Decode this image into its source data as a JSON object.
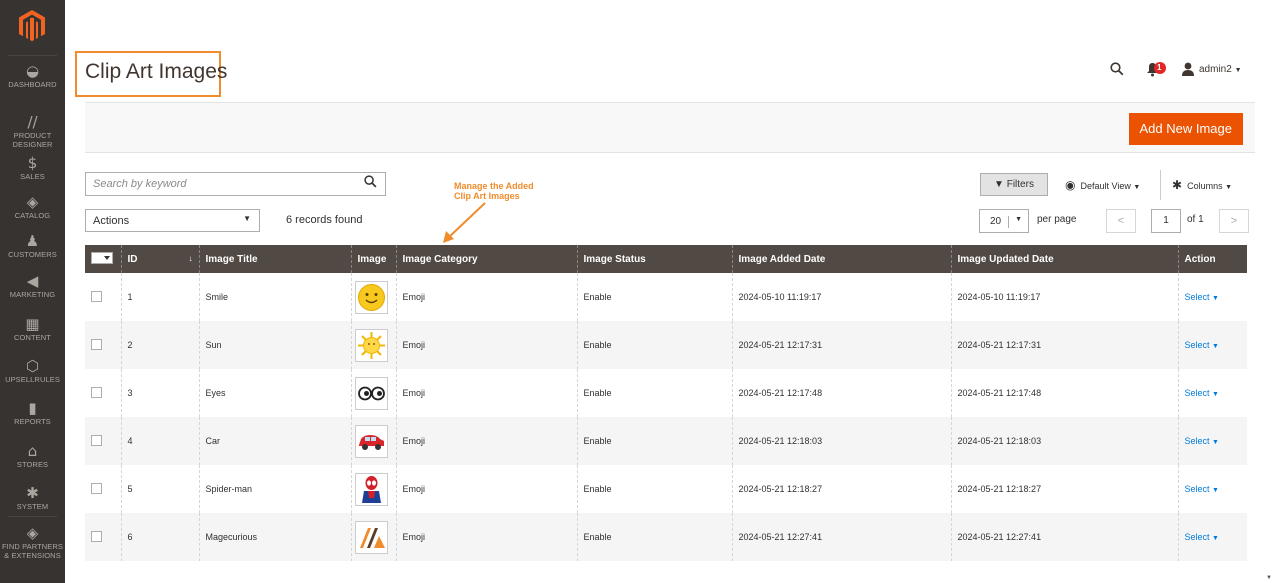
{
  "sidebar": {
    "items": [
      {
        "label": "Dashboard",
        "icon": "dashboard-icon",
        "glyph": "◒"
      },
      {
        "label": "Product Designer",
        "icon": "product-designer-icon",
        "glyph": "//"
      },
      {
        "label": "Sales",
        "icon": "sales-icon",
        "glyph": "$"
      },
      {
        "label": "Catalog",
        "icon": "catalog-icon",
        "glyph": "◈"
      },
      {
        "label": "Customers",
        "icon": "customers-icon",
        "glyph": "♟"
      },
      {
        "label": "Marketing",
        "icon": "marketing-icon",
        "glyph": "◀"
      },
      {
        "label": "Content",
        "icon": "content-icon",
        "glyph": "▦"
      },
      {
        "label": "Upsellrules",
        "icon": "upsellrules-icon",
        "glyph": "⬡"
      },
      {
        "label": "Reports",
        "icon": "reports-icon",
        "glyph": "▮"
      },
      {
        "label": "Stores",
        "icon": "stores-icon",
        "glyph": "⌂"
      },
      {
        "label": "System",
        "icon": "system-icon",
        "glyph": "✱"
      },
      {
        "label": "Find Partners & Extensions",
        "icon": "partners-icon",
        "glyph": "◈"
      }
    ]
  },
  "header": {
    "title": "Clip Art Images",
    "notification_count": "1",
    "user": "admin2"
  },
  "page_actions": {
    "add_label": "Add New Image"
  },
  "toolbar": {
    "search_placeholder": "Search by keyword",
    "actions_label": "Actions",
    "records_found": "6 records found",
    "filters_label": "Filters",
    "default_view_label": "Default View",
    "columns_label": "Columns",
    "per_page_value": "20",
    "per_page_label": "per page",
    "page_current": "1",
    "page_of": "of 1"
  },
  "annotation": {
    "line1": "Manage the Added",
    "line2": "Clip Art Images"
  },
  "grid": {
    "headers": {
      "id": "ID",
      "title": "Image Title",
      "image": "Image",
      "category": "Image Category",
      "status": "Image Status",
      "added": "Image Added Date",
      "updated": "Image Updated Date",
      "action": "Action"
    },
    "rows": [
      {
        "id": "1",
        "title": "Smile",
        "category": "Emoji",
        "status": "Enable",
        "added": "2024-05-10 11:19:17",
        "updated": "2024-05-10 11:19:17",
        "action": "Select",
        "thumb": "smile-emoji-thumbnail"
      },
      {
        "id": "2",
        "title": "Sun",
        "category": "Emoji",
        "status": "Enable",
        "added": "2024-05-21 12:17:31",
        "updated": "2024-05-21 12:17:31",
        "action": "Select",
        "thumb": "sun-thumbnail"
      },
      {
        "id": "3",
        "title": "Eyes",
        "category": "Emoji",
        "status": "Enable",
        "added": "2024-05-21 12:17:48",
        "updated": "2024-05-21 12:17:48",
        "action": "Select",
        "thumb": "eyes-thumbnail"
      },
      {
        "id": "4",
        "title": "Car",
        "category": "Emoji",
        "status": "Enable",
        "added": "2024-05-21 12:18:03",
        "updated": "2024-05-21 12:18:03",
        "action": "Select",
        "thumb": "car-thumbnail"
      },
      {
        "id": "5",
        "title": "Spider-man",
        "category": "Emoji",
        "status": "Enable",
        "added": "2024-05-21 12:18:27",
        "updated": "2024-05-21 12:18:27",
        "action": "Select",
        "thumb": "spiderman-thumbnail"
      },
      {
        "id": "6",
        "title": "Magecurious",
        "category": "Emoji",
        "status": "Enable",
        "added": "2024-05-21 12:27:41",
        "updated": "2024-05-21 12:27:41",
        "action": "Select",
        "thumb": "magecurious-logo-thumbnail"
      }
    ]
  },
  "colors": {
    "accent": "#eb5202",
    "sidebar": "#373330",
    "grid_header": "#514943",
    "link": "#007bdb",
    "annotation": "#f08c2b"
  }
}
